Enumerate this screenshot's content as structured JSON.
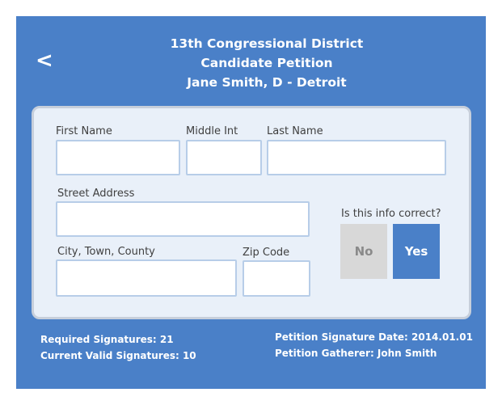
{
  "header": {
    "back_label": "<",
    "line1": "13th Congressional District",
    "line2": "Candidate Petition",
    "line3": "Jane Smith, D - Detroit"
  },
  "form": {
    "first_name_label": "First Name",
    "middle_label": "Middle Int",
    "last_name_label": "Last Name",
    "street_label": "Street Address",
    "city_label": "City, Town, County",
    "zip_label": "Zip Code",
    "first_name_value": "",
    "middle_value": "",
    "last_name_value": "",
    "street_value": "",
    "city_value": "",
    "zip_value": ""
  },
  "confirm": {
    "question": "Is this info correct?",
    "no_label": "No",
    "yes_label": "Yes"
  },
  "footer": {
    "required": "Required Signatures: 21",
    "current": "Current Valid Signatures: 10",
    "date": "Petition Signature Date: 2014.01.01",
    "gatherer": "Petition Gatherer: John Smith"
  },
  "colors": {
    "screen_bg": "#4a80c8",
    "card_bg": "#e9f0f9",
    "yes_button": "#4a80c8",
    "no_button": "#d8d8d8"
  }
}
